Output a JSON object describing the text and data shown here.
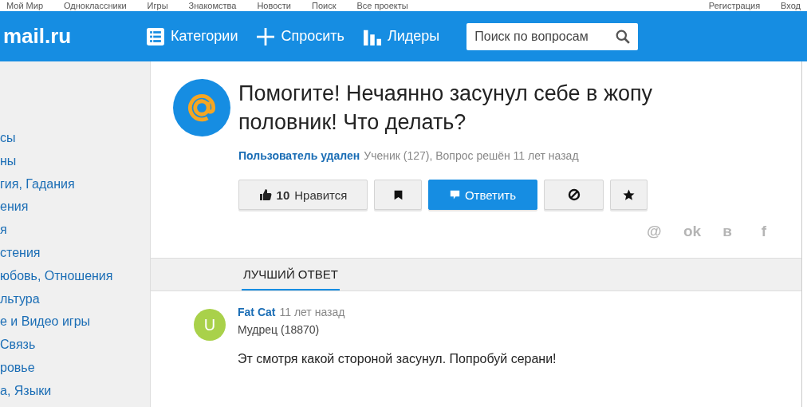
{
  "top_links": [
    "Мой Мир",
    "Одноклассники",
    "Игры",
    "Знакомства",
    "Новости",
    "Поиск",
    "Все проекты"
  ],
  "top_right_links": [
    "Регистрация",
    "Вход"
  ],
  "header": {
    "logo": "mail.ru",
    "nav": [
      {
        "kind": "list",
        "label": "Категории"
      },
      {
        "kind": "plus",
        "label": "Спросить"
      },
      {
        "kind": "bars",
        "label": "Лидеры"
      }
    ],
    "search": {
      "placeholder": "Поиск по вопросам"
    }
  },
  "sidebar": {
    "items": [
      "сы",
      "ны",
      "гия, Гадания",
      "ения",
      "я",
      "стения",
      "юбовь, Отношения",
      "льтура",
      "е и Видео игры",
      "Связь",
      "ровье",
      "а, Языки"
    ]
  },
  "question": {
    "title": "Помогите! Нечаянно засунул себе в жопу половник! Что делать?",
    "author": "Пользователь удален",
    "meta": "Ученик (127), Вопрос решён 11 лет назад",
    "actions": [
      {
        "kind": "like",
        "count": "10",
        "label": "Нравится"
      },
      {
        "kind": "bookmark"
      },
      {
        "kind": "answer",
        "label": "Ответить"
      },
      {
        "kind": "block"
      },
      {
        "kind": "star"
      }
    ],
    "share": [
      "@",
      "ok",
      "в",
      "f"
    ]
  },
  "tabs": [
    {
      "label": "ЛУЧШИЙ ОТВЕТ",
      "selected": true
    }
  ],
  "answer": {
    "avatar_letter": "U",
    "author": "Fat Cat",
    "time": "11 лет назад",
    "rank": "Мудрец (18870)",
    "text": "Эт смотря какой стороной засунул. Попробуй серани!"
  }
}
